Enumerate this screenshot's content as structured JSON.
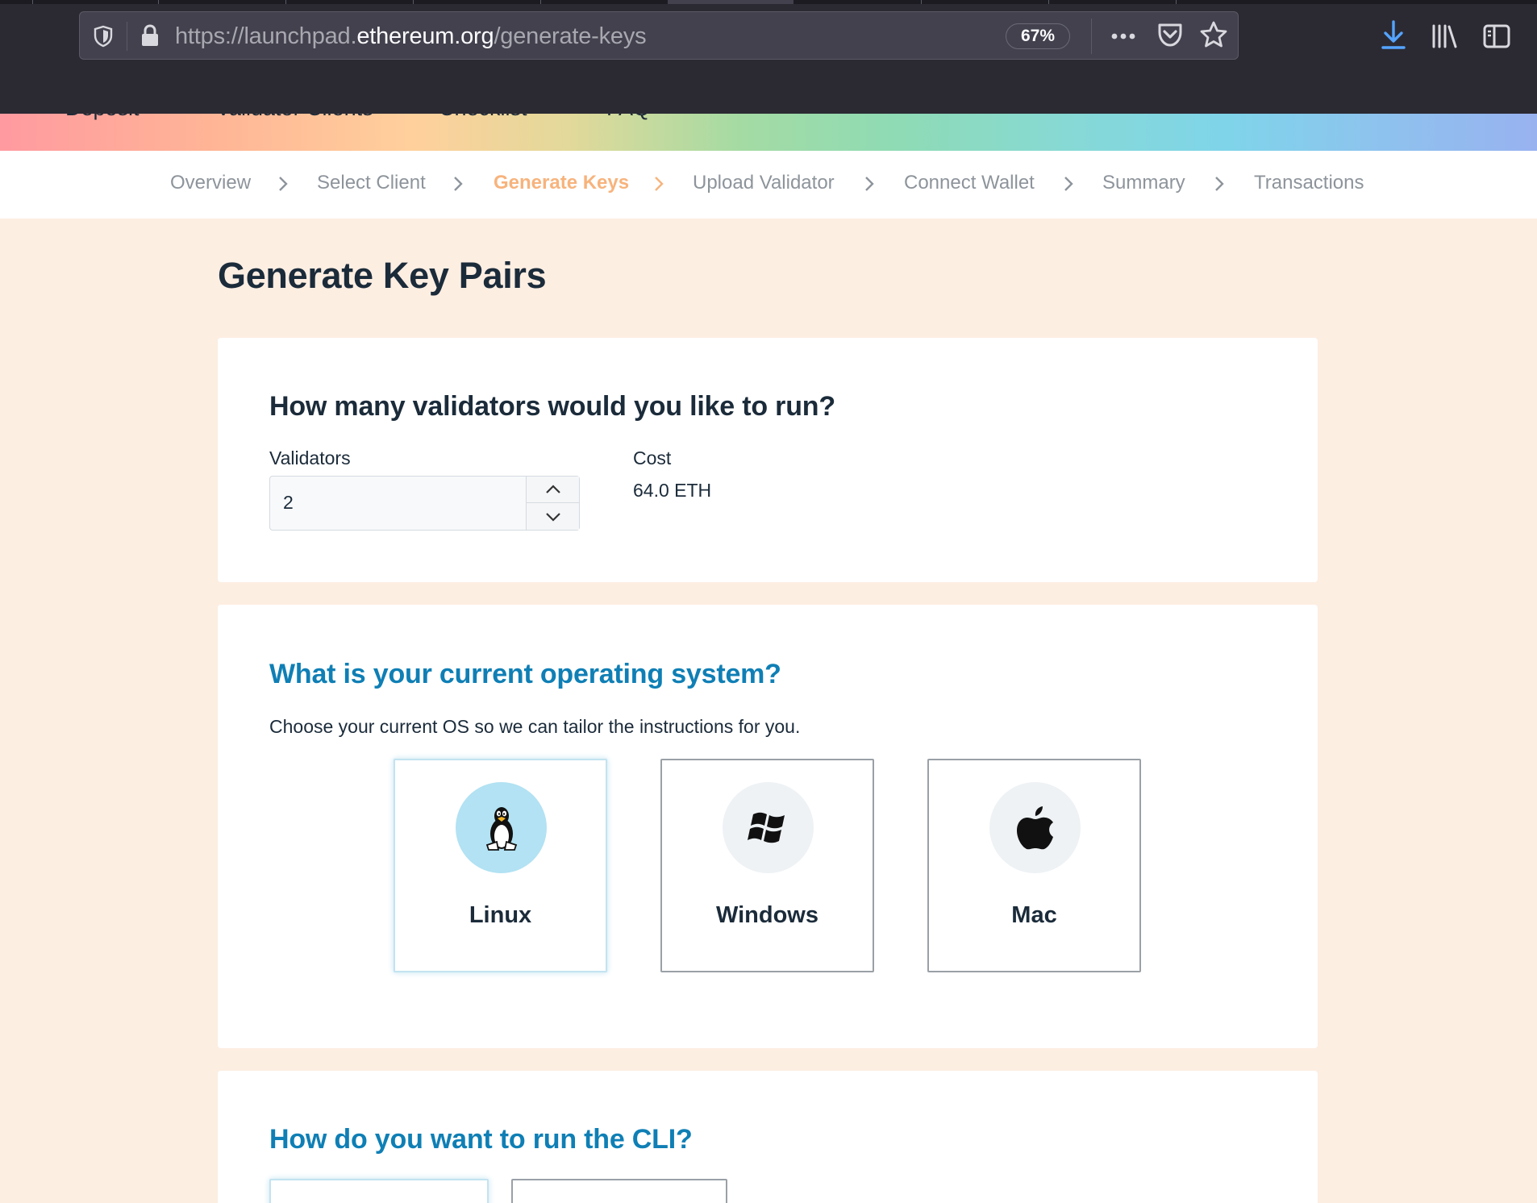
{
  "browser": {
    "url_prefix": "https://launchpad.",
    "url_domain": "ethereum.org",
    "url_path": "/generate-keys",
    "zoom": "67%"
  },
  "top_nav": {
    "items": [
      "Deposit",
      "Validator Clients",
      "Checklist",
      "FAQ"
    ]
  },
  "steps": {
    "items": [
      "Overview",
      "Select Client",
      "Generate Keys",
      "Upload Validator",
      "Connect Wallet",
      "Summary",
      "Transactions"
    ],
    "active": "Generate Keys",
    "active_color": "#f7b37c"
  },
  "page": {
    "title": "Generate Key Pairs"
  },
  "validators_section": {
    "heading": "How many validators would you like to run?",
    "validators_label": "Validators",
    "validators_value": "2",
    "cost_label": "Cost",
    "cost_value": "64.0 ETH"
  },
  "os_section": {
    "heading": "What is your current operating system?",
    "subtext": "Choose your current OS so we can tailor the instructions for you.",
    "options": [
      {
        "label": "Linux",
        "icon": "linux-penguin-icon",
        "selected": true
      },
      {
        "label": "Windows",
        "icon": "windows-logo-icon",
        "selected": false
      },
      {
        "label": "Mac",
        "icon": "apple-logo-icon",
        "selected": false
      }
    ]
  },
  "cli_section": {
    "heading": "How do you want to run the CLI?"
  },
  "colors": {
    "heading_blue": "#0f7fb5",
    "dark_text": "#1b2b3a",
    "page_bg": "#fdeee2",
    "selected_circle": "#b2e2f3"
  }
}
